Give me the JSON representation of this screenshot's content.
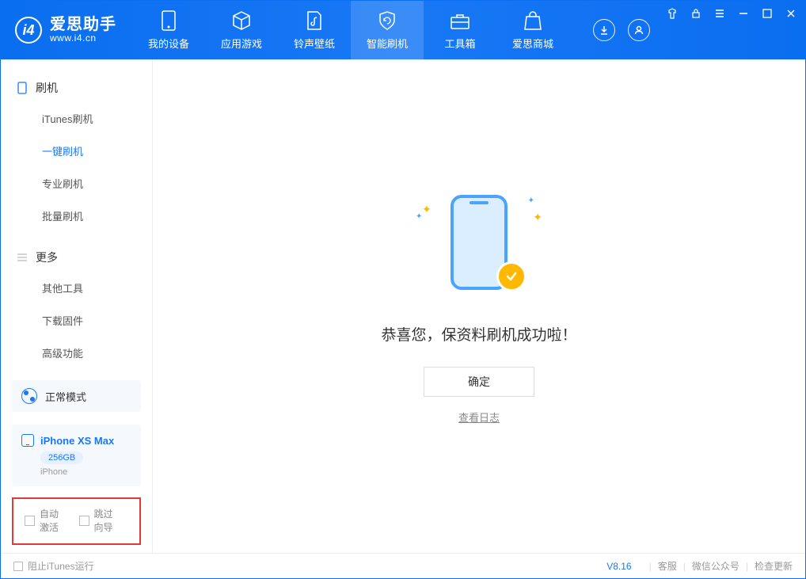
{
  "app": {
    "title": "爱思助手",
    "subtitle": "www.i4.cn"
  },
  "tabs": [
    {
      "label": "我的设备"
    },
    {
      "label": "应用游戏"
    },
    {
      "label": "铃声壁纸"
    },
    {
      "label": "智能刷机"
    },
    {
      "label": "工具箱"
    },
    {
      "label": "爱思商城"
    }
  ],
  "sidebar": {
    "group1": {
      "title": "刷机",
      "items": [
        "iTunes刷机",
        "一键刷机",
        "专业刷机",
        "批量刷机"
      ]
    },
    "group2": {
      "title": "更多",
      "items": [
        "其他工具",
        "下载固件",
        "高级功能"
      ]
    }
  },
  "mode": {
    "label": "正常模式"
  },
  "device": {
    "name": "iPhone XS Max",
    "capacity": "256GB",
    "type": "iPhone"
  },
  "options": {
    "auto_activate": "自动激活",
    "skip_guide": "跳过向导"
  },
  "main": {
    "success_msg": "恭喜您，保资料刷机成功啦！",
    "ok_btn": "确定",
    "log_link": "查看日志"
  },
  "statusbar": {
    "block_itunes": "阻止iTunes运行",
    "version": "V8.16",
    "links": [
      "客服",
      "微信公众号",
      "检查更新"
    ]
  }
}
